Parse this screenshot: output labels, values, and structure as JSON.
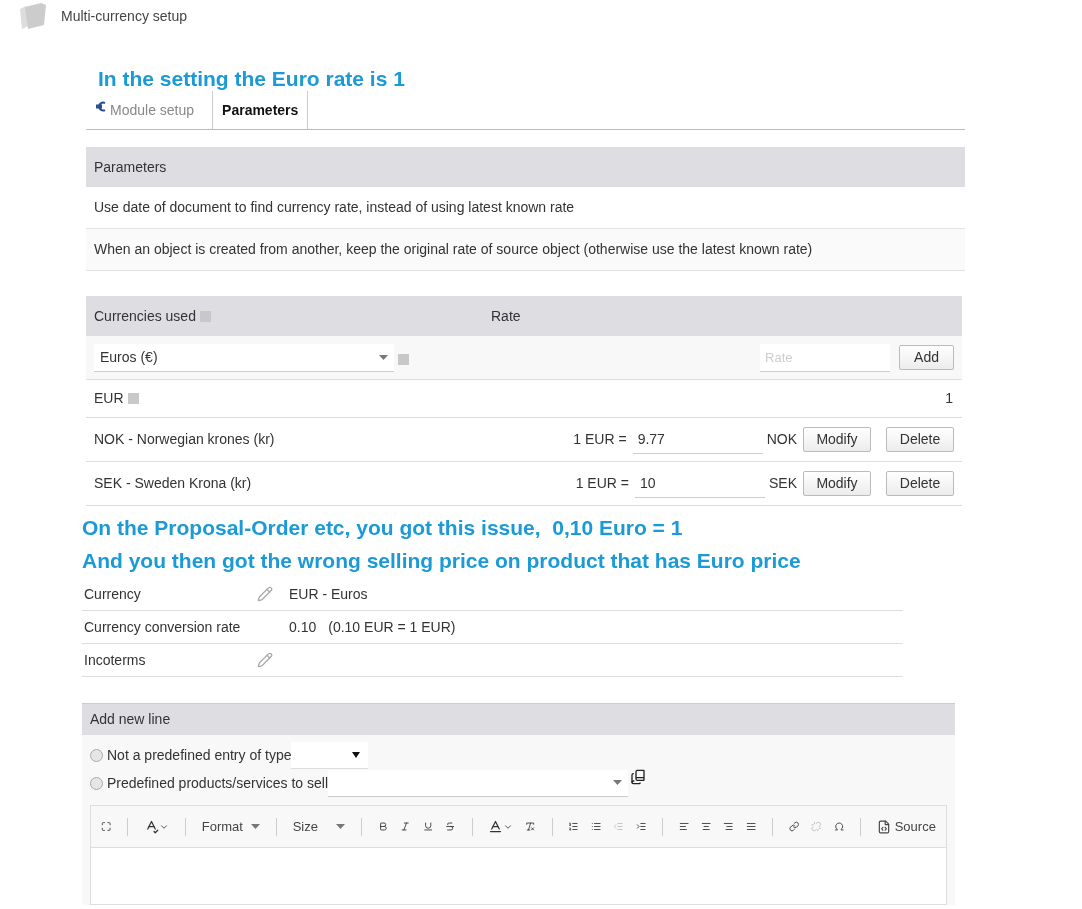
{
  "header": {
    "title": "Multi-currency setup"
  },
  "annotation_top": {
    "lines": [
      "In the setting the Euro rate is 1"
    ]
  },
  "tabs": [
    {
      "label": "Module setup",
      "selected": false
    },
    {
      "label": "Parameters",
      "selected": true
    }
  ],
  "parameters": {
    "title": "Parameters",
    "rows": [
      "Use date of document to find currency rate, instead of using latest known rate",
      "When an object is created from another, keep the original rate of source object (otherwise use the latest known rate)"
    ]
  },
  "currencies": {
    "columns": [
      "Currencies used",
      "Rate"
    ],
    "add_row": {
      "select_value": "Euros (€)",
      "rate_placeholder": "Rate",
      "button": "Add"
    },
    "rows": [
      {
        "kind": "base",
        "name": "EUR",
        "rate": "1"
      },
      {
        "kind": "editable",
        "name": "NOK - Norwegian krones (kr)",
        "prefix": "1 EUR =",
        "rate": "9.77",
        "unit": "NOK",
        "buttons": [
          "Modify",
          "Delete"
        ]
      },
      {
        "kind": "editable",
        "name": "SEK - Sweden Krona (kr)",
        "prefix": "1 EUR =",
        "rate": "10",
        "unit": "SEK",
        "buttons": [
          "Modify",
          "Delete"
        ]
      }
    ]
  },
  "annotation_bottom": {
    "lines": [
      "On the Proposal-Order etc, you got this issue,  0,10 Euro = 1",
      "And you then got the wrong selling price on product that has Euro price"
    ]
  },
  "document_fields": [
    {
      "label": "Currency",
      "editable": true,
      "value": "EUR - Euros"
    },
    {
      "label": "Currency conversion rate",
      "editable": false,
      "value": "0.10",
      "note": "(0.10 EUR = 1 EUR)"
    },
    {
      "label": "Incoterms",
      "editable": true
    }
  ],
  "add_line": {
    "title": "Add new line",
    "options": [
      {
        "kind": "type_select",
        "label": "Not a predefined entry of type",
        "selected": false
      },
      {
        "kind": "product_select",
        "label": "Predefined products/services to sell",
        "selected": false
      }
    ],
    "editor": {
      "format": "Format",
      "size": "Size",
      "source": "Source"
    }
  }
}
